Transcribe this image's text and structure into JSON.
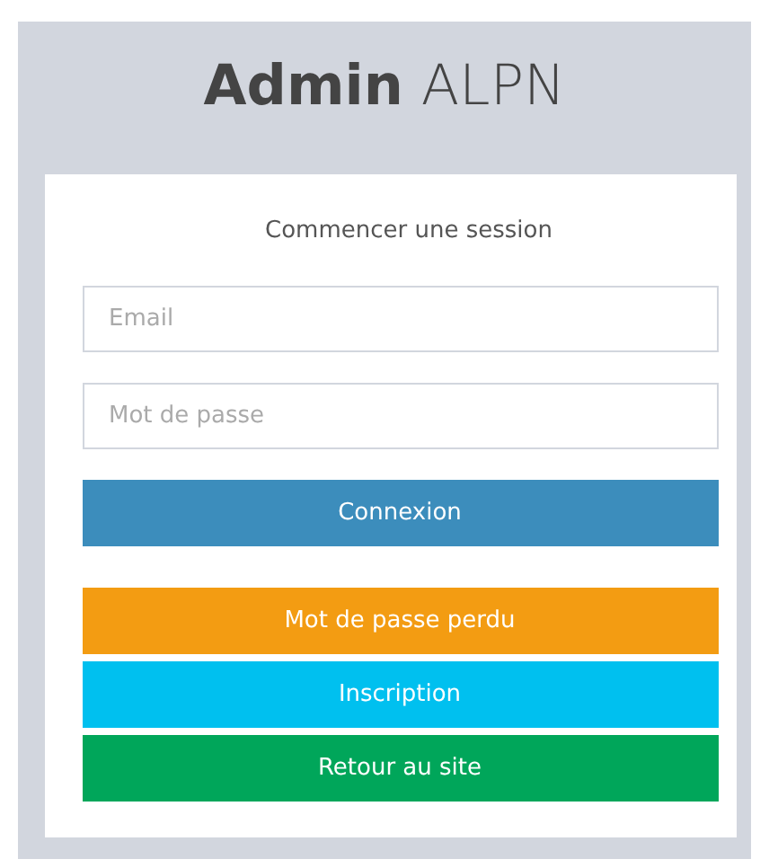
{
  "logo": {
    "text": "**Admin** ALPN"
  },
  "login_box": {
    "message": "Commencer une session",
    "fields": [
      {
        "placeholder": "Email"
      },
      {
        "placeholder": "Mot de passe"
      }
    ],
    "buttons": [
      {
        "label": "Connexion",
        "color": "#3c8dbc"
      },
      {
        "label": "Mot de passe perdu",
        "color": "#f39c12"
      },
      {
        "label": "Inscription",
        "color": "#00c0ef"
      },
      {
        "label": "Retour au site",
        "color": "#00a65a"
      }
    ]
  }
}
